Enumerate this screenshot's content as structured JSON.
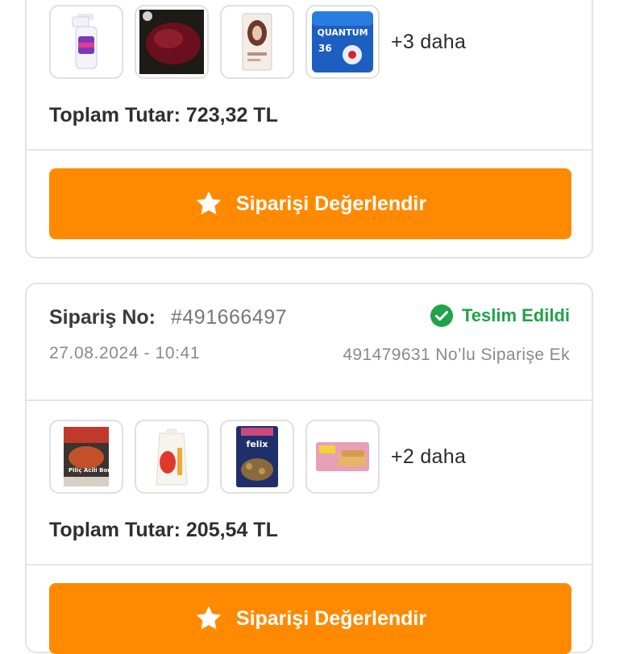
{
  "orders": [
    {
      "products": [
        {
          "icon": "cleaning-spray-icon",
          "label": ""
        },
        {
          "icon": "liver-meat-icon",
          "label": ""
        },
        {
          "icon": "hair-dye-icon",
          "label": ""
        },
        {
          "icon": "dishwasher-tablets-icon",
          "label": "QUANTUM"
        }
      ],
      "more_label": "+3 daha",
      "total_label": "Toplam Tutar: 723,32 TL",
      "rate_label": "Siparişi Değerlendir"
    },
    {
      "order_no_label": "Sipariş No:",
      "order_no": "#491666497",
      "status": "Teslim Edildi",
      "date": "27.08.2024 - 10:41",
      "reference": "491479631 No’lu Siparişe Ek",
      "products": [
        {
          "icon": "chicken-package-icon",
          "label": "Piliç Acili Bonfile"
        },
        {
          "icon": "plastic-bag-icon",
          "label": ""
        },
        {
          "icon": "cat-food-icon",
          "label": "felix"
        },
        {
          "icon": "wafer-package-icon",
          "label": ""
        }
      ],
      "more_label": "+2 daha",
      "total_label": "Toplam Tutar: 205,54 TL",
      "rate_label": "Siparişi Değerlendir"
    }
  ],
  "colors": {
    "accent": "#ff8a00",
    "success": "#21a348",
    "border": "#e3e3e3"
  }
}
